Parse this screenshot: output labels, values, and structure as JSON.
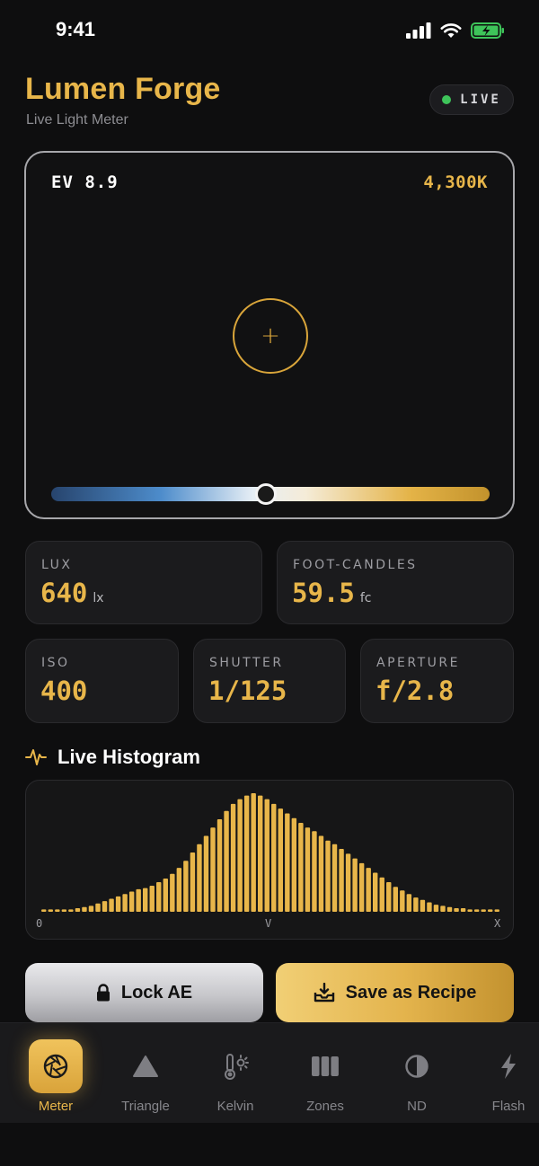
{
  "status_bar": {
    "time": "9:41"
  },
  "header": {
    "title": "Lumen Forge",
    "subtitle": "Live Light Meter",
    "live_label": "LIVE"
  },
  "viewfinder": {
    "ev": "EV 8.9",
    "kelvin": "4,300K",
    "temperature_position": 0.49
  },
  "metrics": {
    "lux": {
      "label": "LUX",
      "value": "640",
      "unit": "lx"
    },
    "foot_candles": {
      "label": "FOOT-CANDLES",
      "value": "59.5",
      "unit": "fc"
    },
    "iso": {
      "label": "ISO",
      "value": "400"
    },
    "shutter": {
      "label": "SHUTTER",
      "value": "1/125"
    },
    "aperture": {
      "label": "APERTURE",
      "value": "f/2.8"
    }
  },
  "histogram": {
    "title": "Live Histogram",
    "axis": [
      "0",
      "V",
      "X"
    ],
    "bars": [
      0.02,
      0.02,
      0.02,
      0.02,
      0.02,
      0.03,
      0.04,
      0.05,
      0.07,
      0.09,
      0.11,
      0.13,
      0.15,
      0.17,
      0.19,
      0.2,
      0.22,
      0.25,
      0.28,
      0.32,
      0.37,
      0.43,
      0.5,
      0.57,
      0.64,
      0.71,
      0.78,
      0.85,
      0.91,
      0.95,
      0.98,
      1.0,
      0.98,
      0.95,
      0.91,
      0.87,
      0.83,
      0.79,
      0.75,
      0.71,
      0.68,
      0.64,
      0.6,
      0.57,
      0.53,
      0.49,
      0.45,
      0.41,
      0.37,
      0.33,
      0.29,
      0.25,
      0.21,
      0.18,
      0.15,
      0.12,
      0.1,
      0.08,
      0.06,
      0.05,
      0.04,
      0.03,
      0.03,
      0.02,
      0.02,
      0.02,
      0.02,
      0.02
    ],
    "bar_color": "#e8b64a"
  },
  "actions": {
    "lock_label": "Lock AE",
    "save_label": "Save as Recipe"
  },
  "tabs": [
    {
      "label": "Meter",
      "icon": "aperture-icon",
      "active": true
    },
    {
      "label": "Triangle",
      "icon": "triangle-icon",
      "active": false
    },
    {
      "label": "Kelvin",
      "icon": "thermometer-sun-icon",
      "active": false
    },
    {
      "label": "Zones",
      "icon": "zones-icon",
      "active": false
    },
    {
      "label": "ND",
      "icon": "half-circle-icon",
      "active": false
    },
    {
      "label": "Flash",
      "icon": "bolt-icon",
      "active": false
    }
  ],
  "colors": {
    "accent": "#e8b64a",
    "live_dot": "#3ec45a",
    "background": "#0e0e0f"
  }
}
